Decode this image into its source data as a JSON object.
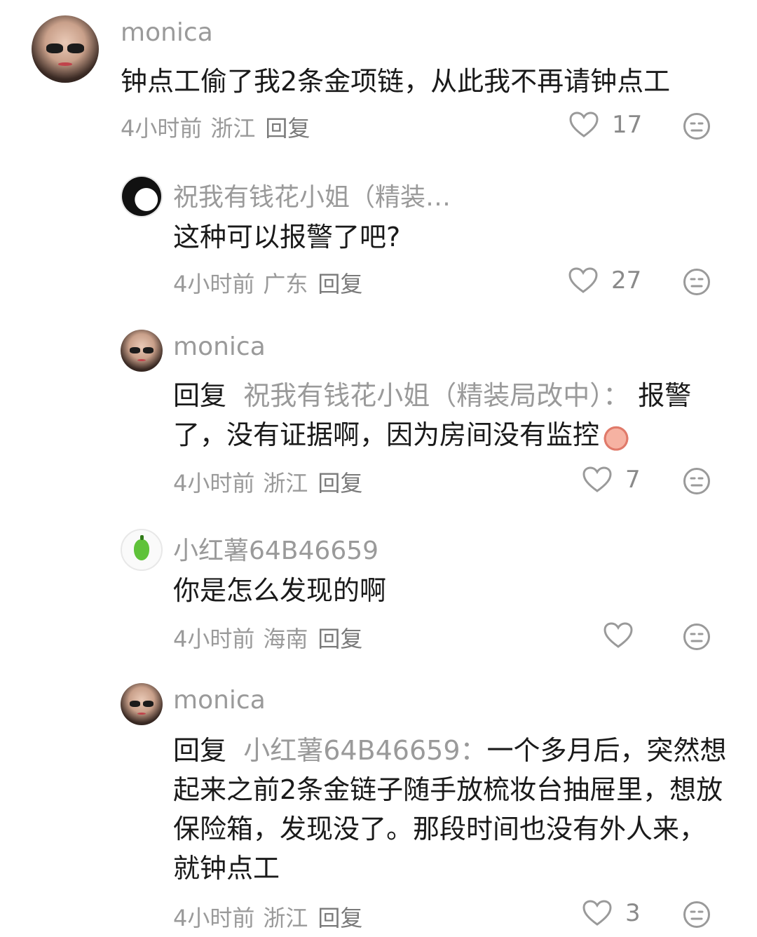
{
  "comments": [
    {
      "author": "monica",
      "text": "钟点工偷了我2条金项链，从此我不再请钟点工",
      "time": "4小时前",
      "location": "浙江",
      "reply_label": "回复",
      "likes": "17",
      "avatar_icon": "woman-sunglasses-avatar"
    },
    {
      "author": "祝我有钱花小姐（精装…",
      "text": "这种可以报警了吧?",
      "time": "4小时前",
      "location": "广东",
      "reply_label": "回复",
      "likes": "27",
      "avatar_icon": "sketch-girl-avatar"
    },
    {
      "author": "monica",
      "reply_prefix": "回复",
      "reply_target": "祝我有钱花小姐（精装局改中）：",
      "text": "报警了，没有证据啊，因为房间没有监控",
      "emoji": "crying-face-emoji",
      "time": "4小时前",
      "location": "浙江",
      "reply_label": "回复",
      "likes": "7",
      "avatar_icon": "woman-sunglasses-avatar"
    },
    {
      "author": "小红薯64B46659",
      "text": "你是怎么发现的啊",
      "time": "4小时前",
      "location": "海南",
      "reply_label": "回复",
      "likes": "",
      "avatar_icon": "green-pepper-avatar"
    },
    {
      "author": "monica",
      "reply_prefix": "回复",
      "reply_target": "小红薯64B46659：",
      "text": "一个多月后，突然想起来之前2条金链子随手放梳妆台抽屉里，想放保险箱，发现没了。那段时间也没有外人来，就钟点工",
      "time": "4小时前",
      "location": "浙江",
      "reply_label": "回复",
      "likes": "3",
      "avatar_icon": "woman-sunglasses-avatar"
    }
  ],
  "colors": {
    "secondary_text": "#9a9a9a",
    "primary_text": "#1a1a1a",
    "icon": "#9a9a9a"
  }
}
